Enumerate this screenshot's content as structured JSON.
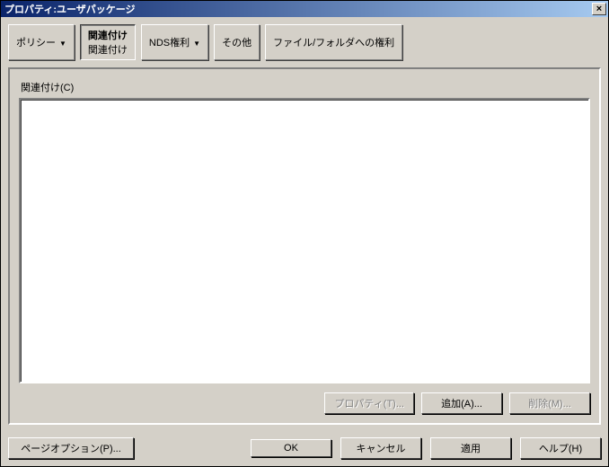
{
  "titlebar": {
    "title": "プロパティ:ユーザパッケージ",
    "close_glyph": "×"
  },
  "tabs": {
    "policy": "ポリシー",
    "assoc_line1": "関連付け",
    "assoc_line2": "関連付け",
    "nds": "NDS権利",
    "other": "その他",
    "file_folder": "ファイル/フォルダへの権利"
  },
  "panel": {
    "list_label": "関連付け(C)",
    "buttons": {
      "property": "プロパティ(T)...",
      "add": "追加(A)...",
      "delete": "削除(M)..."
    }
  },
  "footer": {
    "page_options": "ページオプション(P)...",
    "ok": "OK",
    "cancel": "キャンセル",
    "apply": "適用",
    "help": "ヘルプ(H)"
  }
}
